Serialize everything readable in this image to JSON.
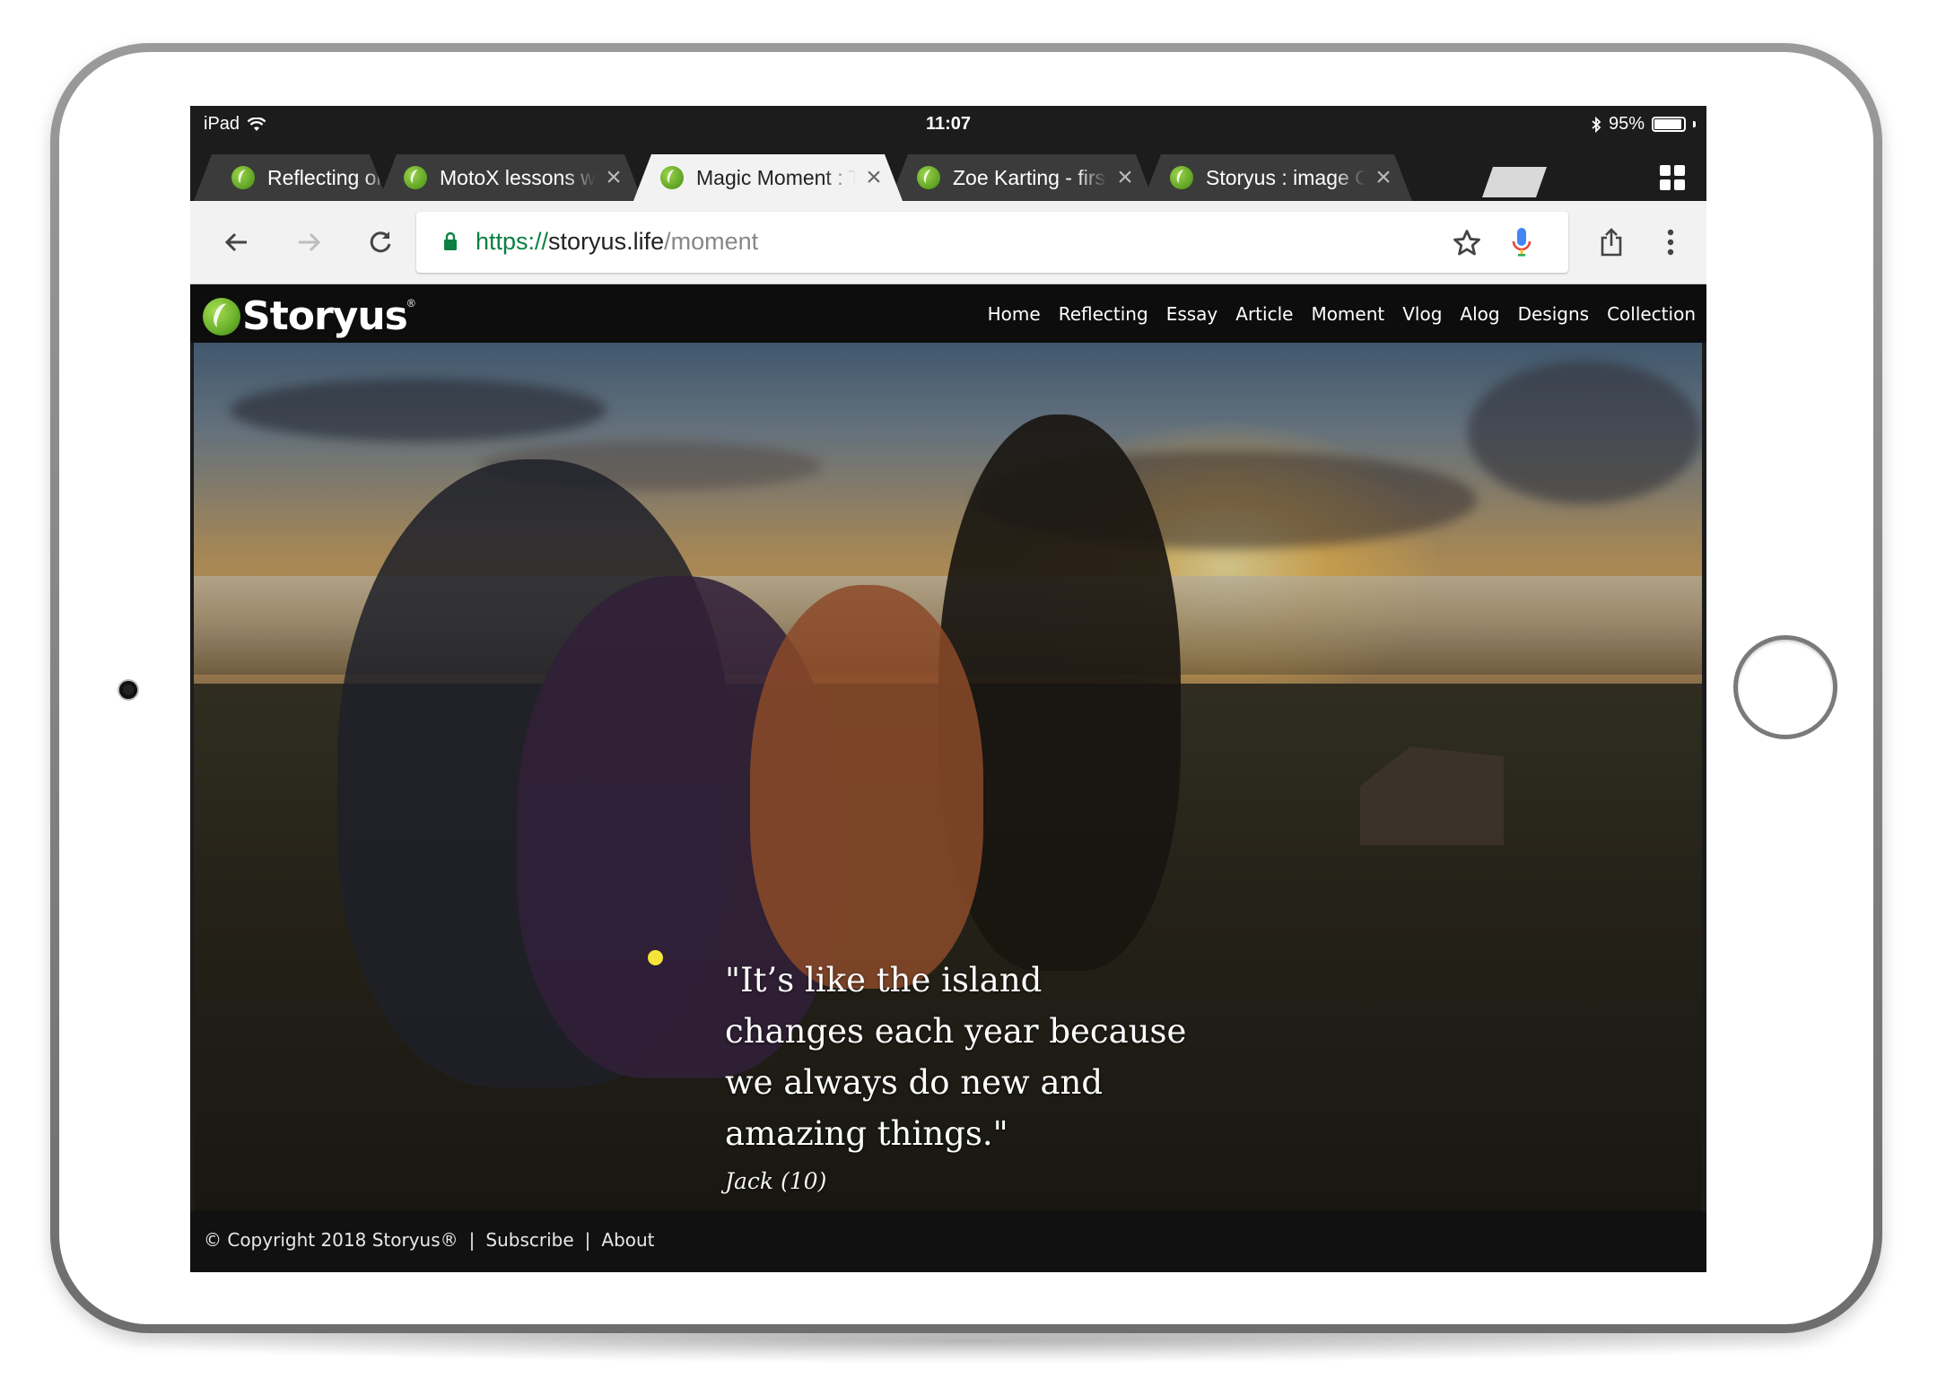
{
  "status_bar": {
    "device": "iPad",
    "time": "11:07",
    "battery_percent": "95%",
    "battery_level": 0.95
  },
  "tabs": [
    {
      "title": "Reflecting on t",
      "active": false
    },
    {
      "title": "MotoX lessons wi",
      "active": false
    },
    {
      "title": "Magic Moment : T",
      "active": true
    },
    {
      "title": "Zoe Karting - first",
      "active": false
    },
    {
      "title": "Storyus : image C",
      "active": false
    }
  ],
  "tab_close_glyph": "×",
  "omnibox": {
    "scheme": "https://",
    "host": "storyus.life",
    "path": "/moment"
  },
  "site": {
    "logo": "Storyus",
    "logo_mark": "®",
    "nav": [
      "Home",
      "Reflecting",
      "Essay",
      "Article",
      "Moment",
      "Vlog",
      "Alog",
      "Designs",
      "Collection"
    ]
  },
  "hero": {
    "quote": "\"It’s like the island changes each year because we always do new and amazing things.\"",
    "author": "Jack (10)",
    "marker_color": "#f6e43a"
  },
  "footer": {
    "copyright": "© Copyright 2018 Storyus®",
    "sep1": "|",
    "subscribe": "Subscribe",
    "sep2": "|",
    "about": "About"
  },
  "colors": {
    "brand_green": "#6cb12b",
    "url_scheme": "#0b8043",
    "nav_bg": "#0d0d0d"
  },
  "icons": [
    "wifi-icon",
    "bluetooth-icon",
    "battery-icon",
    "favicon-icon",
    "close-icon",
    "new-tab-icon",
    "tab-switcher-icon",
    "back-arrow-icon",
    "forward-arrow-icon",
    "reload-icon",
    "lock-icon",
    "star-icon",
    "microphone-icon",
    "share-icon",
    "more-vert-icon",
    "storyus-logo-icon"
  ]
}
